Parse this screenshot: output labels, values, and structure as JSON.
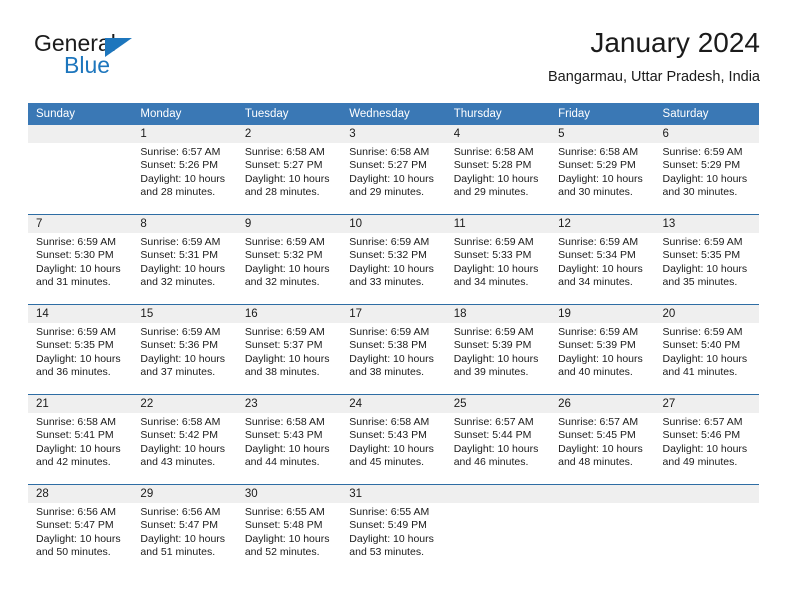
{
  "logo": {
    "primary_text": "General",
    "secondary_text": "Blue",
    "accent_color": "#1d76bd",
    "triangle_icon": "triangle-icon"
  },
  "header": {
    "title": "January 2024",
    "subtitle": "Bangarmau, Uttar Pradesh, India"
  },
  "theme": {
    "header_bg": "#3a78b5",
    "row_separator": "#2e6da4",
    "daynum_bg": "#efefef",
    "text": "#1b1b1b"
  },
  "calendar": {
    "weekday_headers": [
      "Sunday",
      "Monday",
      "Tuesday",
      "Wednesday",
      "Thursday",
      "Friday",
      "Saturday"
    ],
    "weeks": [
      [
        {
          "day": "",
          "lines": []
        },
        {
          "day": "1",
          "lines": [
            "Sunrise: 6:57 AM",
            "Sunset: 5:26 PM",
            "Daylight: 10 hours",
            "and 28 minutes."
          ]
        },
        {
          "day": "2",
          "lines": [
            "Sunrise: 6:58 AM",
            "Sunset: 5:27 PM",
            "Daylight: 10 hours",
            "and 28 minutes."
          ]
        },
        {
          "day": "3",
          "lines": [
            "Sunrise: 6:58 AM",
            "Sunset: 5:27 PM",
            "Daylight: 10 hours",
            "and 29 minutes."
          ]
        },
        {
          "day": "4",
          "lines": [
            "Sunrise: 6:58 AM",
            "Sunset: 5:28 PM",
            "Daylight: 10 hours",
            "and 29 minutes."
          ]
        },
        {
          "day": "5",
          "lines": [
            "Sunrise: 6:58 AM",
            "Sunset: 5:29 PM",
            "Daylight: 10 hours",
            "and 30 minutes."
          ]
        },
        {
          "day": "6",
          "lines": [
            "Sunrise: 6:59 AM",
            "Sunset: 5:29 PM",
            "Daylight: 10 hours",
            "and 30 minutes."
          ]
        }
      ],
      [
        {
          "day": "7",
          "lines": [
            "Sunrise: 6:59 AM",
            "Sunset: 5:30 PM",
            "Daylight: 10 hours",
            "and 31 minutes."
          ]
        },
        {
          "day": "8",
          "lines": [
            "Sunrise: 6:59 AM",
            "Sunset: 5:31 PM",
            "Daylight: 10 hours",
            "and 32 minutes."
          ]
        },
        {
          "day": "9",
          "lines": [
            "Sunrise: 6:59 AM",
            "Sunset: 5:32 PM",
            "Daylight: 10 hours",
            "and 32 minutes."
          ]
        },
        {
          "day": "10",
          "lines": [
            "Sunrise: 6:59 AM",
            "Sunset: 5:32 PM",
            "Daylight: 10 hours",
            "and 33 minutes."
          ]
        },
        {
          "day": "11",
          "lines": [
            "Sunrise: 6:59 AM",
            "Sunset: 5:33 PM",
            "Daylight: 10 hours",
            "and 34 minutes."
          ]
        },
        {
          "day": "12",
          "lines": [
            "Sunrise: 6:59 AM",
            "Sunset: 5:34 PM",
            "Daylight: 10 hours",
            "and 34 minutes."
          ]
        },
        {
          "day": "13",
          "lines": [
            "Sunrise: 6:59 AM",
            "Sunset: 5:35 PM",
            "Daylight: 10 hours",
            "and 35 minutes."
          ]
        }
      ],
      [
        {
          "day": "14",
          "lines": [
            "Sunrise: 6:59 AM",
            "Sunset: 5:35 PM",
            "Daylight: 10 hours",
            "and 36 minutes."
          ]
        },
        {
          "day": "15",
          "lines": [
            "Sunrise: 6:59 AM",
            "Sunset: 5:36 PM",
            "Daylight: 10 hours",
            "and 37 minutes."
          ]
        },
        {
          "day": "16",
          "lines": [
            "Sunrise: 6:59 AM",
            "Sunset: 5:37 PM",
            "Daylight: 10 hours",
            "and 38 minutes."
          ]
        },
        {
          "day": "17",
          "lines": [
            "Sunrise: 6:59 AM",
            "Sunset: 5:38 PM",
            "Daylight: 10 hours",
            "and 38 minutes."
          ]
        },
        {
          "day": "18",
          "lines": [
            "Sunrise: 6:59 AM",
            "Sunset: 5:39 PM",
            "Daylight: 10 hours",
            "and 39 minutes."
          ]
        },
        {
          "day": "19",
          "lines": [
            "Sunrise: 6:59 AM",
            "Sunset: 5:39 PM",
            "Daylight: 10 hours",
            "and 40 minutes."
          ]
        },
        {
          "day": "20",
          "lines": [
            "Sunrise: 6:59 AM",
            "Sunset: 5:40 PM",
            "Daylight: 10 hours",
            "and 41 minutes."
          ]
        }
      ],
      [
        {
          "day": "21",
          "lines": [
            "Sunrise: 6:58 AM",
            "Sunset: 5:41 PM",
            "Daylight: 10 hours",
            "and 42 minutes."
          ]
        },
        {
          "day": "22",
          "lines": [
            "Sunrise: 6:58 AM",
            "Sunset: 5:42 PM",
            "Daylight: 10 hours",
            "and 43 minutes."
          ]
        },
        {
          "day": "23",
          "lines": [
            "Sunrise: 6:58 AM",
            "Sunset: 5:43 PM",
            "Daylight: 10 hours",
            "and 44 minutes."
          ]
        },
        {
          "day": "24",
          "lines": [
            "Sunrise: 6:58 AM",
            "Sunset: 5:43 PM",
            "Daylight: 10 hours",
            "and 45 minutes."
          ]
        },
        {
          "day": "25",
          "lines": [
            "Sunrise: 6:57 AM",
            "Sunset: 5:44 PM",
            "Daylight: 10 hours",
            "and 46 minutes."
          ]
        },
        {
          "day": "26",
          "lines": [
            "Sunrise: 6:57 AM",
            "Sunset: 5:45 PM",
            "Daylight: 10 hours",
            "and 48 minutes."
          ]
        },
        {
          "day": "27",
          "lines": [
            "Sunrise: 6:57 AM",
            "Sunset: 5:46 PM",
            "Daylight: 10 hours",
            "and 49 minutes."
          ]
        }
      ],
      [
        {
          "day": "28",
          "lines": [
            "Sunrise: 6:56 AM",
            "Sunset: 5:47 PM",
            "Daylight: 10 hours",
            "and 50 minutes."
          ]
        },
        {
          "day": "29",
          "lines": [
            "Sunrise: 6:56 AM",
            "Sunset: 5:47 PM",
            "Daylight: 10 hours",
            "and 51 minutes."
          ]
        },
        {
          "day": "30",
          "lines": [
            "Sunrise: 6:55 AM",
            "Sunset: 5:48 PM",
            "Daylight: 10 hours",
            "and 52 minutes."
          ]
        },
        {
          "day": "31",
          "lines": [
            "Sunrise: 6:55 AM",
            "Sunset: 5:49 PM",
            "Daylight: 10 hours",
            "and 53 minutes."
          ]
        },
        {
          "day": "",
          "lines": []
        },
        {
          "day": "",
          "lines": []
        },
        {
          "day": "",
          "lines": []
        }
      ]
    ]
  }
}
